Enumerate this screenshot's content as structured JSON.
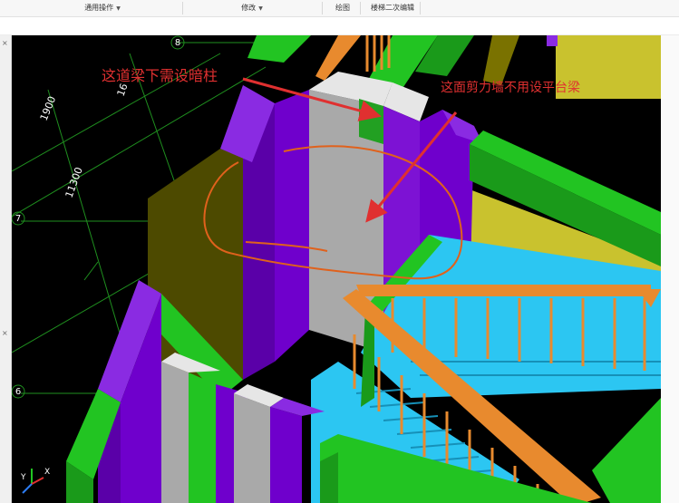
{
  "toolbar": {
    "general_ops": "通用操作",
    "modify": "修改",
    "draw": "绘图",
    "stair_edit": "楼梯二次编辑"
  },
  "viewport": {
    "axis_labels": {
      "axis_8": "8",
      "axis_7": "7",
      "axis_6": "6"
    },
    "dimensions": {
      "dim_1900": "1900",
      "dim_11300": "11300",
      "dim_partial": "16"
    },
    "annotations": {
      "hidden_column_note": "这道梁下需设暗柱",
      "shear_wall_note": "这面剪力墙不用设平台梁"
    },
    "triad": {
      "y_label": "Y",
      "x_label": "X"
    }
  },
  "colors": {
    "wall_purple": "#6f00cc",
    "beam_green": "#22c422",
    "stair_cyan": "#2cc6f2",
    "railing_orange": "#e88a2e",
    "slab_yellow": "#c9c22e",
    "concrete_gray": "#a9a9a9",
    "annotation_red": "#e03030"
  }
}
